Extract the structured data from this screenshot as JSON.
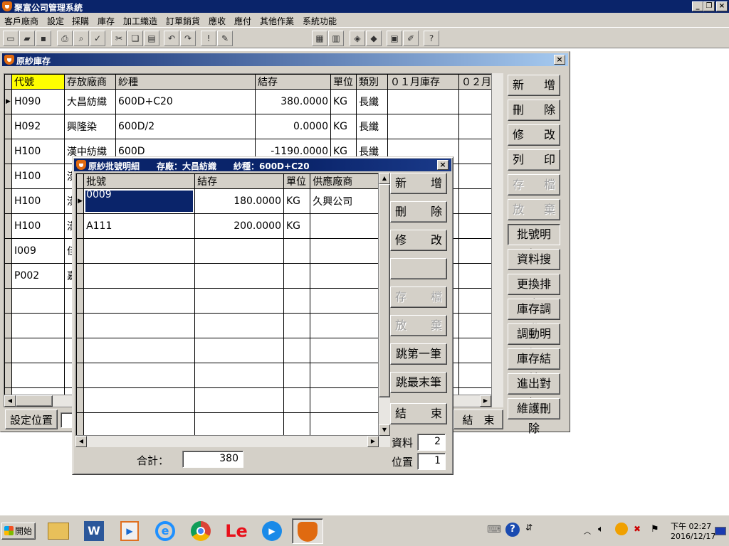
{
  "app": {
    "title": "聚富公司管理系統"
  },
  "menu": [
    "客戶廠商",
    "設定",
    "採購",
    "庫存",
    "加工織造",
    "訂單銷貨",
    "應收",
    "應付",
    "其他作業",
    "系統功能"
  ],
  "toolbar": {
    "combo_value": ""
  },
  "main_window": {
    "title": "原紗庫存",
    "columns": [
      "代號",
      "存放廠商",
      "紗種",
      "結存",
      "單位",
      "類別",
      "０１月庫存",
      "０２月"
    ],
    "rows": [
      {
        "code": "H090",
        "vendor": "大昌紡織",
        "yarn": "600D+C20",
        "stock": "380.0000",
        "unit": "KG",
        "type": "長纖"
      },
      {
        "code": "H092",
        "vendor": "興隆染",
        "yarn": "600D/2",
        "stock": "0.0000",
        "unit": "KG",
        "type": "長纖"
      },
      {
        "code": "H100",
        "vendor": "漢中紡織",
        "yarn": "600D",
        "stock": "-1190.0000",
        "unit": "KG",
        "type": "長纖"
      },
      {
        "code": "H100",
        "vendor": "漢",
        "yarn": "",
        "stock": "",
        "unit": "",
        "type": ""
      },
      {
        "code": "H100",
        "vendor": "漢",
        "yarn": "",
        "stock": "",
        "unit": "",
        "type": ""
      },
      {
        "code": "H100",
        "vendor": "漢",
        "yarn": "",
        "stock": "",
        "unit": "",
        "type": ""
      },
      {
        "code": "I009",
        "vendor": "佳",
        "yarn": "",
        "stock": "",
        "unit": "",
        "type": ""
      },
      {
        "code": "P002",
        "vendor": "嘉",
        "yarn": "",
        "stock": "",
        "unit": "",
        "type": ""
      }
    ],
    "buttons": [
      {
        "label": "新增",
        "disabled": false
      },
      {
        "label": "刪除",
        "disabled": false
      },
      {
        "label": "修改",
        "disabled": false
      },
      {
        "label": "列印",
        "disabled": false
      },
      {
        "label": "存檔",
        "disabled": true
      },
      {
        "label": "放棄",
        "disabled": true
      },
      {
        "label": "批號明細",
        "disabled": false
      },
      {
        "label": "資料搜尋",
        "disabled": false
      },
      {
        "label": "更換排序",
        "disabled": false
      },
      {
        "label": "庫存調動",
        "disabled": false
      },
      {
        "label": "調動明細",
        "disabled": false
      },
      {
        "label": "庫存結轉",
        "disabled": false
      },
      {
        "label": "進出對帳",
        "disabled": false
      },
      {
        "label": "維護刪除",
        "disabled": false
      }
    ],
    "set_position_label": "設定位置",
    "end_label": "結　束"
  },
  "lot_dialog": {
    "title": "原紗批號明細　　存廠：大昌紡織　　紗種：600D+C20",
    "columns": [
      "批號",
      "結存",
      "單位",
      "供應廠商"
    ],
    "rows": [
      {
        "lot": "0009",
        "stock": "180.0000",
        "unit": "KG",
        "supplier": "久興公司"
      },
      {
        "lot": "A111",
        "stock": "200.0000",
        "unit": "KG",
        "supplier": ""
      }
    ],
    "buttons": [
      {
        "label": "新增",
        "disabled": false
      },
      {
        "label": "刪除",
        "disabled": false
      },
      {
        "label": "修改",
        "disabled": false
      },
      {
        "label": "",
        "disabled": false
      },
      {
        "label": "存檔",
        "disabled": true
      },
      {
        "label": "放棄",
        "disabled": true
      },
      {
        "label": "跳第一筆",
        "disabled": false
      },
      {
        "label": "跳最末筆",
        "disabled": false
      },
      {
        "label": "結束",
        "disabled": false
      }
    ],
    "total_label": "合計：",
    "total_value": "380",
    "records_label": "資料",
    "records_value": "2",
    "position_label": "位置",
    "position_value": "1"
  },
  "taskbar": {
    "start_label": "開始",
    "clock_period": "下午 02:27",
    "clock_date": "2016/12/17",
    "apps": [
      "file-explorer-icon",
      "word-icon",
      "media-player-icon",
      "ie-icon",
      "chrome-icon",
      "le-icon",
      "player-icon",
      "fox-app-icon"
    ]
  }
}
